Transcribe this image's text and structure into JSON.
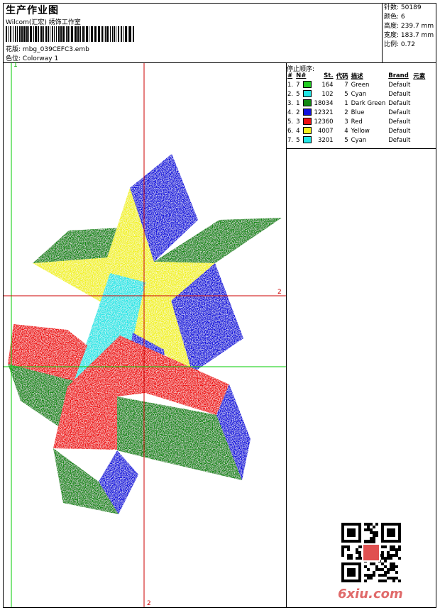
{
  "header": {
    "title": "生产作业图",
    "company": "Wilcom(汇宏) 绣饰工作室",
    "design_label": "花版:",
    "design_name": "mbg_039CEFC3.emb",
    "colorway_label": "色位:",
    "colorway_name": "Colorway 1"
  },
  "stats": [
    {
      "label": "针数:",
      "value": "50189"
    },
    {
      "label": "颜色:",
      "value": "6"
    },
    {
      "label": "高度:",
      "value": "239.7 mm"
    },
    {
      "label": "宽度:",
      "value": "183.7 mm"
    },
    {
      "label": "比例:",
      "value": "0.72"
    }
  ],
  "stop_sequence": {
    "title": "停止顺序:",
    "headers": [
      "#",
      "N#",
      "St.",
      "代码",
      "描述",
      "Brand",
      "元素"
    ],
    "rows": [
      {
        "idx": "1.",
        "n": "7",
        "color": "#22cc22",
        "st": "164",
        "code": "7",
        "desc": "Green",
        "brand": "Default"
      },
      {
        "idx": "2.",
        "n": "5",
        "color": "#22e6e6",
        "st": "102",
        "code": "5",
        "desc": "Cyan",
        "brand": "Default"
      },
      {
        "idx": "3.",
        "n": "1",
        "color": "#118811",
        "st": "18034",
        "code": "1",
        "desc": "Dark Green",
        "brand": "Default"
      },
      {
        "idx": "4.",
        "n": "2",
        "color": "#1111dd",
        "st": "12321",
        "code": "2",
        "desc": "Blue",
        "brand": "Default"
      },
      {
        "idx": "5.",
        "n": "3",
        "color": "#ee1111",
        "st": "12360",
        "code": "3",
        "desc": "Red",
        "brand": "Default"
      },
      {
        "idx": "6.",
        "n": "4",
        "color": "#f2f21e",
        "st": "4007",
        "code": "4",
        "desc": "Yellow",
        "brand": "Default"
      },
      {
        "idx": "7.",
        "n": "5",
        "color": "#22e6e6",
        "st": "3201",
        "code": "5",
        "desc": "Cyan",
        "brand": "Default"
      }
    ]
  },
  "guides": {
    "top_marker": "1",
    "right_marker": "2",
    "bottom_marker": "2"
  },
  "watermark": "6xiu.com"
}
